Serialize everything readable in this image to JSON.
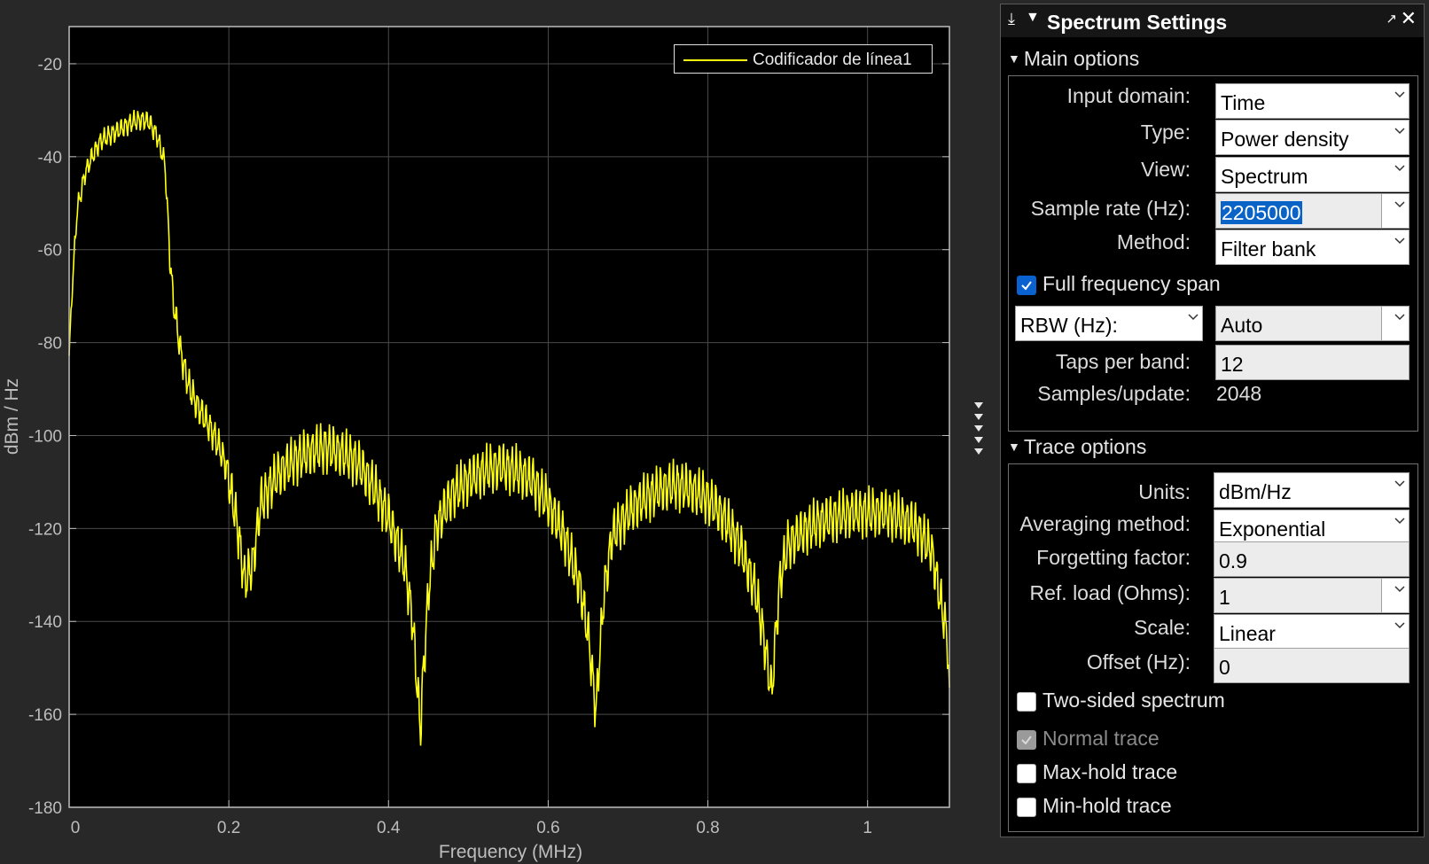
{
  "chart_data": {
    "type": "line",
    "xlabel": "Frequency (MHz)",
    "ylabel": "dBm / Hz",
    "xlim": [
      0,
      1.1025
    ],
    "ylim": [
      -180,
      -12
    ],
    "xticks": [
      "0",
      "0.2",
      "0.4",
      "0.6",
      "0.8",
      "1"
    ],
    "yticks": [
      "-20",
      "-40",
      "-60",
      "-80",
      "-100",
      "-120",
      "-140",
      "-160",
      "-180"
    ],
    "grid": true,
    "legend": "top-right",
    "series": [
      {
        "name": "Codificador de línea1",
        "color": "#ffff10",
        "x": [
          0,
          0.004,
          0.01,
          0.02,
          0.03,
          0.04,
          0.05,
          0.06,
          0.07,
          0.08,
          0.09,
          0.1,
          0.11,
          0.12,
          0.125,
          0.13,
          0.14,
          0.15,
          0.16,
          0.17,
          0.18,
          0.19,
          0.2,
          0.21,
          0.22,
          0.23,
          0.24,
          0.26,
          0.28,
          0.3,
          0.32,
          0.34,
          0.36,
          0.38,
          0.4,
          0.42,
          0.43,
          0.44,
          0.443,
          0.45,
          0.46,
          0.48,
          0.5,
          0.52,
          0.54,
          0.56,
          0.58,
          0.6,
          0.62,
          0.64,
          0.65,
          0.66,
          0.663,
          0.67,
          0.68,
          0.7,
          0.72,
          0.74,
          0.76,
          0.78,
          0.8,
          0.82,
          0.84,
          0.86,
          0.87,
          0.88,
          0.883,
          0.89,
          0.9,
          0.92,
          0.94,
          0.96,
          0.98,
          1.0,
          1.02,
          1.04,
          1.06,
          1.08,
          1.1,
          1.1025
        ],
        "y": [
          -82,
          -66,
          -50,
          -42,
          -38,
          -35,
          -34,
          -33,
          -32,
          -31,
          -30.5,
          -31,
          -34,
          -40,
          -56,
          -68,
          -80,
          -87,
          -91,
          -94,
          -97,
          -101,
          -106,
          -115,
          -128,
          -124,
          -111,
          -105,
          -102,
          -100,
          -99,
          -100,
          -102,
          -107,
          -114,
          -124,
          -136,
          -160,
          -149,
          -130,
          -116,
          -109,
          -106,
          -104,
          -103,
          -104,
          -106,
          -111,
          -118,
          -129,
          -139,
          -156,
          -147,
          -130,
          -118,
          -113,
          -110,
          -108,
          -107,
          -108,
          -110,
          -114,
          -120,
          -130,
          -140,
          -152,
          -144,
          -128,
          -120,
          -117,
          -115,
          -114,
          -113,
          -113,
          -113,
          -114,
          -116,
          -121,
          -140,
          -153
        ]
      }
    ]
  },
  "panel": {
    "title": "Spectrum Settings",
    "pin_icon": "pin-icon",
    "undock_icon": "undock-icon",
    "close_icon": "close-icon",
    "main_options": {
      "header": "Main options",
      "input_domain_label": "Input domain:",
      "input_domain_value": "Time",
      "type_label": "Type:",
      "type_value": "Power density",
      "view_label": "View:",
      "view_value": "Spectrum",
      "sample_rate_label": "Sample rate (Hz):",
      "sample_rate_value": "2205000",
      "method_label": "Method:",
      "method_value": "Filter bank",
      "full_span_label": "Full frequency span",
      "full_span_checked": true,
      "rbw_label": "RBW (Hz):",
      "rbw_value": "Auto",
      "taps_label": "Taps per band:",
      "taps_value": "12",
      "samples_label": "Samples/update:",
      "samples_value": "2048"
    },
    "trace_options": {
      "header": "Trace options",
      "units_label": "Units:",
      "units_value": "dBm/Hz",
      "averaging_label": "Averaging method:",
      "averaging_value": "Exponential",
      "forgetting_label": "Forgetting factor:",
      "forgetting_value": "0.9",
      "refload_label": "Ref. load (Ohms):",
      "refload_value": "1",
      "scale_label": "Scale:",
      "scale_value": "Linear",
      "offset_label": "Offset (Hz):",
      "offset_value": "0",
      "two_sided_label": "Two-sided spectrum",
      "normal_trace_label": "Normal trace",
      "maxhold_label": "Max-hold trace",
      "minhold_label": "Min-hold trace"
    }
  }
}
